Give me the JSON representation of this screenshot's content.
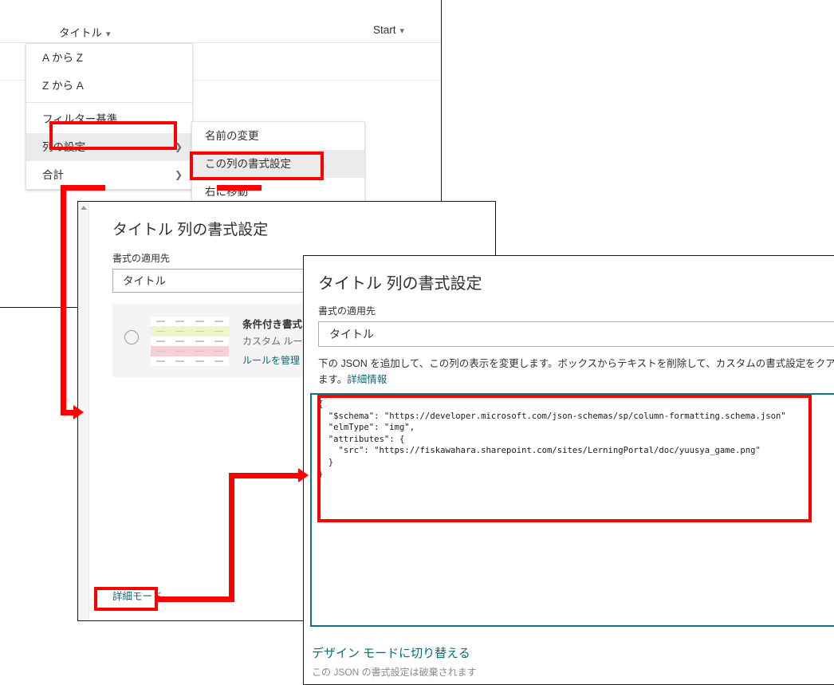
{
  "list_window": {
    "columns": [
      {
        "label": "タイトル",
        "chevron": "chevron-down-icon"
      },
      {
        "label": "Start",
        "chevron": "chevron-down-icon"
      }
    ]
  },
  "column_menu": {
    "items": [
      {
        "label": "A から Z",
        "submenu": false,
        "selected": false
      },
      {
        "label": "Z から A",
        "submenu": false,
        "selected": false
      },
      {
        "label": "フィルター基準",
        "submenu": false,
        "selected": false
      },
      {
        "label": "列の設定",
        "submenu": true,
        "selected": true,
        "chevron": "chevron-right-icon"
      },
      {
        "label": "合計",
        "submenu": true,
        "selected": false,
        "chevron": "chevron-right-icon"
      }
    ]
  },
  "column_submenu": {
    "items": [
      {
        "label": "名前の変更",
        "selected": false
      },
      {
        "label": "この列の書式設定",
        "selected": true
      },
      {
        "label": "右に移動",
        "selected": false
      }
    ]
  },
  "panel_design": {
    "title": "タイトル 列の書式設定",
    "field_label": "書式の適用先",
    "select_value": "タイトル",
    "conditional_card": {
      "title": "条件付き書式",
      "description": "カスタム ルールを使用してリス",
      "link": "ルールを管理"
    },
    "advanced_mode_link": "詳細モード"
  },
  "panel_advanced": {
    "title": "タイトル 列の書式設定",
    "field_label": "書式の適用先",
    "select_value": "タイトル",
    "description_part1": "下の JSON を追加して、この列の表示を変更します。ボックスからテキストを削除して、カスタムの書式設定をク",
    "description_part2": "アします。",
    "description_link": "詳細情報",
    "json_value": "{\n  \"$schema\": \"https://developer.microsoft.com/json-schemas/sp/column-formatting.schema.json\"\n  \"elmType\": \"img\",\n  \"attributes\": {\n    \"src\": \"https://fiskawahara.sharepoint.com/sites/LerningPortal/doc/yuusya_game.png\"\n  }\n}",
    "design_mode_link": "デザイン モードに切り替える",
    "design_mode_note": "この JSON の書式設定は破棄されます"
  },
  "annotations": {
    "highlight_color": "#ff0000",
    "boxes": [
      {
        "name": "highlight-column-settings"
      },
      {
        "name": "highlight-format-this-column"
      },
      {
        "name": "highlight-advanced-mode"
      },
      {
        "name": "highlight-json-editor"
      }
    ]
  },
  "colors": {
    "accent_teal": "#0b6a75",
    "annotation_red": "#ff0000",
    "text_primary": "#323130",
    "menu_selected_bg": "#ebebeb"
  }
}
